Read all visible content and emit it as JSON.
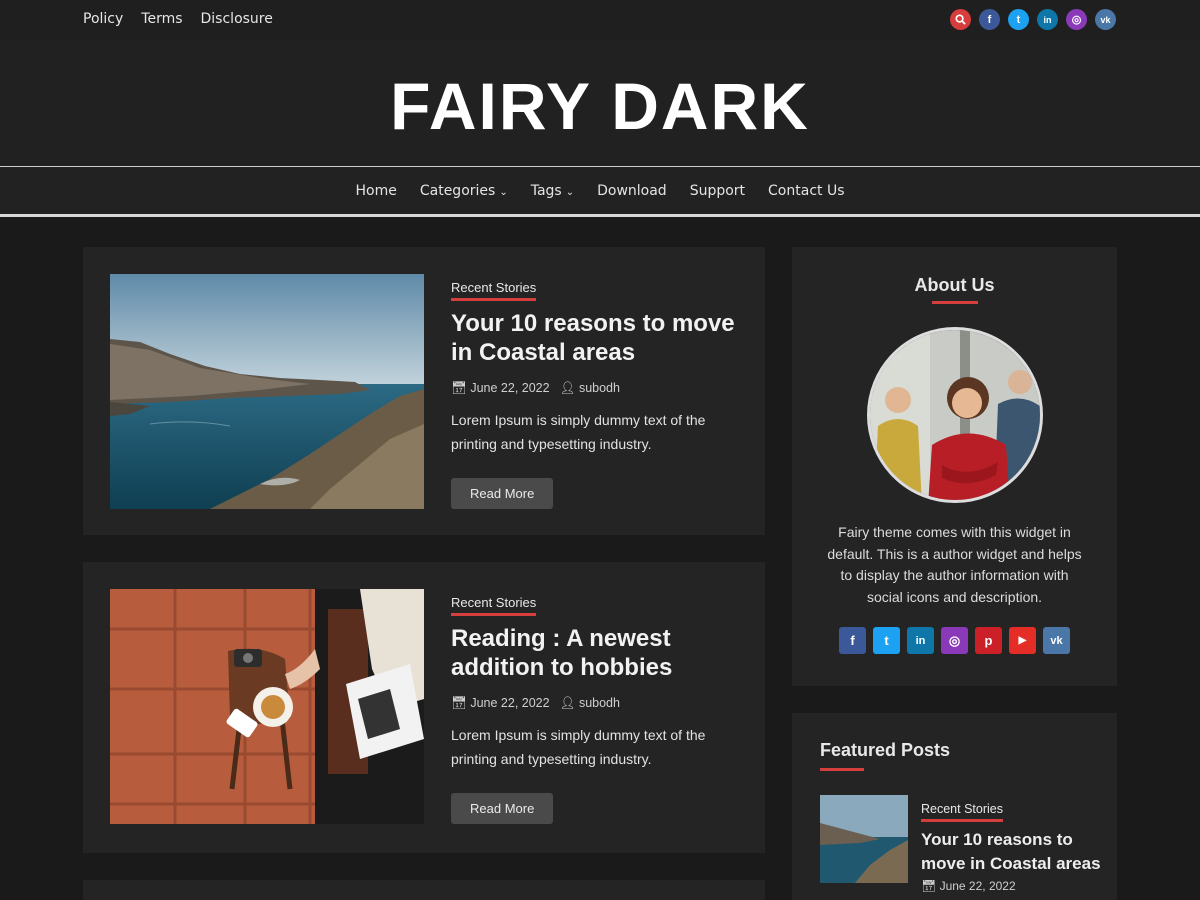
{
  "topbar": {
    "links": [
      "Policy",
      "Terms",
      "Disclosure"
    ],
    "social": [
      {
        "icon": "search-icon",
        "glyph": "⌕",
        "color": "#d63d3d"
      },
      {
        "icon": "facebook-icon",
        "glyph": "f",
        "color": "#3b5998"
      },
      {
        "icon": "twitter-icon",
        "glyph": "t",
        "color": "#1da1f2"
      },
      {
        "icon": "linkedin-icon",
        "glyph": "in",
        "color": "#0e76a8"
      },
      {
        "icon": "instagram-icon",
        "glyph": "◎",
        "color": "#8a3ab9"
      },
      {
        "icon": "vk-icon",
        "glyph": "vk",
        "color": "#4a76a8"
      }
    ]
  },
  "header": {
    "site_title": "FAIRY DARK"
  },
  "nav": {
    "items": [
      {
        "label": "Home",
        "dropdown": false
      },
      {
        "label": "Categories",
        "dropdown": true
      },
      {
        "label": "Tags",
        "dropdown": true
      },
      {
        "label": "Download",
        "dropdown": false
      },
      {
        "label": "Support",
        "dropdown": false
      },
      {
        "label": "Contact Us",
        "dropdown": false
      }
    ]
  },
  "posts": [
    {
      "category": "Recent Stories",
      "title": "Your 10 reasons to move in Coastal areas",
      "date": "June 22, 2022",
      "author": "subodh",
      "excerpt": "Lorem Ipsum is simply dummy text of the printing and typesetting industry.",
      "button": "Read More"
    },
    {
      "category": "Recent Stories",
      "title": "Reading : A newest addition to hobbies",
      "date": "June 22, 2022",
      "author": "subodh",
      "excerpt": "Lorem Ipsum is simply dummy text of the printing and typesetting industry.",
      "button": "Read More"
    }
  ],
  "sidebar": {
    "about": {
      "title": "About Us",
      "description": "Fairy theme comes with this widget in default. This is a author widget and helps to display the author information with social icons and description.",
      "social": [
        {
          "icon": "facebook-icon",
          "glyph": "f",
          "color": "#3b5998"
        },
        {
          "icon": "twitter-icon",
          "glyph": "t",
          "color": "#1da1f2"
        },
        {
          "icon": "linkedin-icon",
          "glyph": "in",
          "color": "#0e76a8"
        },
        {
          "icon": "instagram-icon",
          "glyph": "◎",
          "color": "#8a3ab9"
        },
        {
          "icon": "pinterest-icon",
          "glyph": "p",
          "color": "#cb2027"
        },
        {
          "icon": "youtube-icon",
          "glyph": "▶",
          "color": "#e52d27"
        },
        {
          "icon": "vk-icon",
          "glyph": "vk",
          "color": "#4a76a8"
        }
      ]
    },
    "featured": {
      "title": "Featured Posts",
      "item": {
        "category": "Recent Stories",
        "title": "Your 10 reasons to move in Coastal areas",
        "date": "June 22, 2022"
      }
    }
  },
  "colors": {
    "accent": "#d63d3d",
    "background": "#1a1a1a",
    "card": "#242424"
  }
}
